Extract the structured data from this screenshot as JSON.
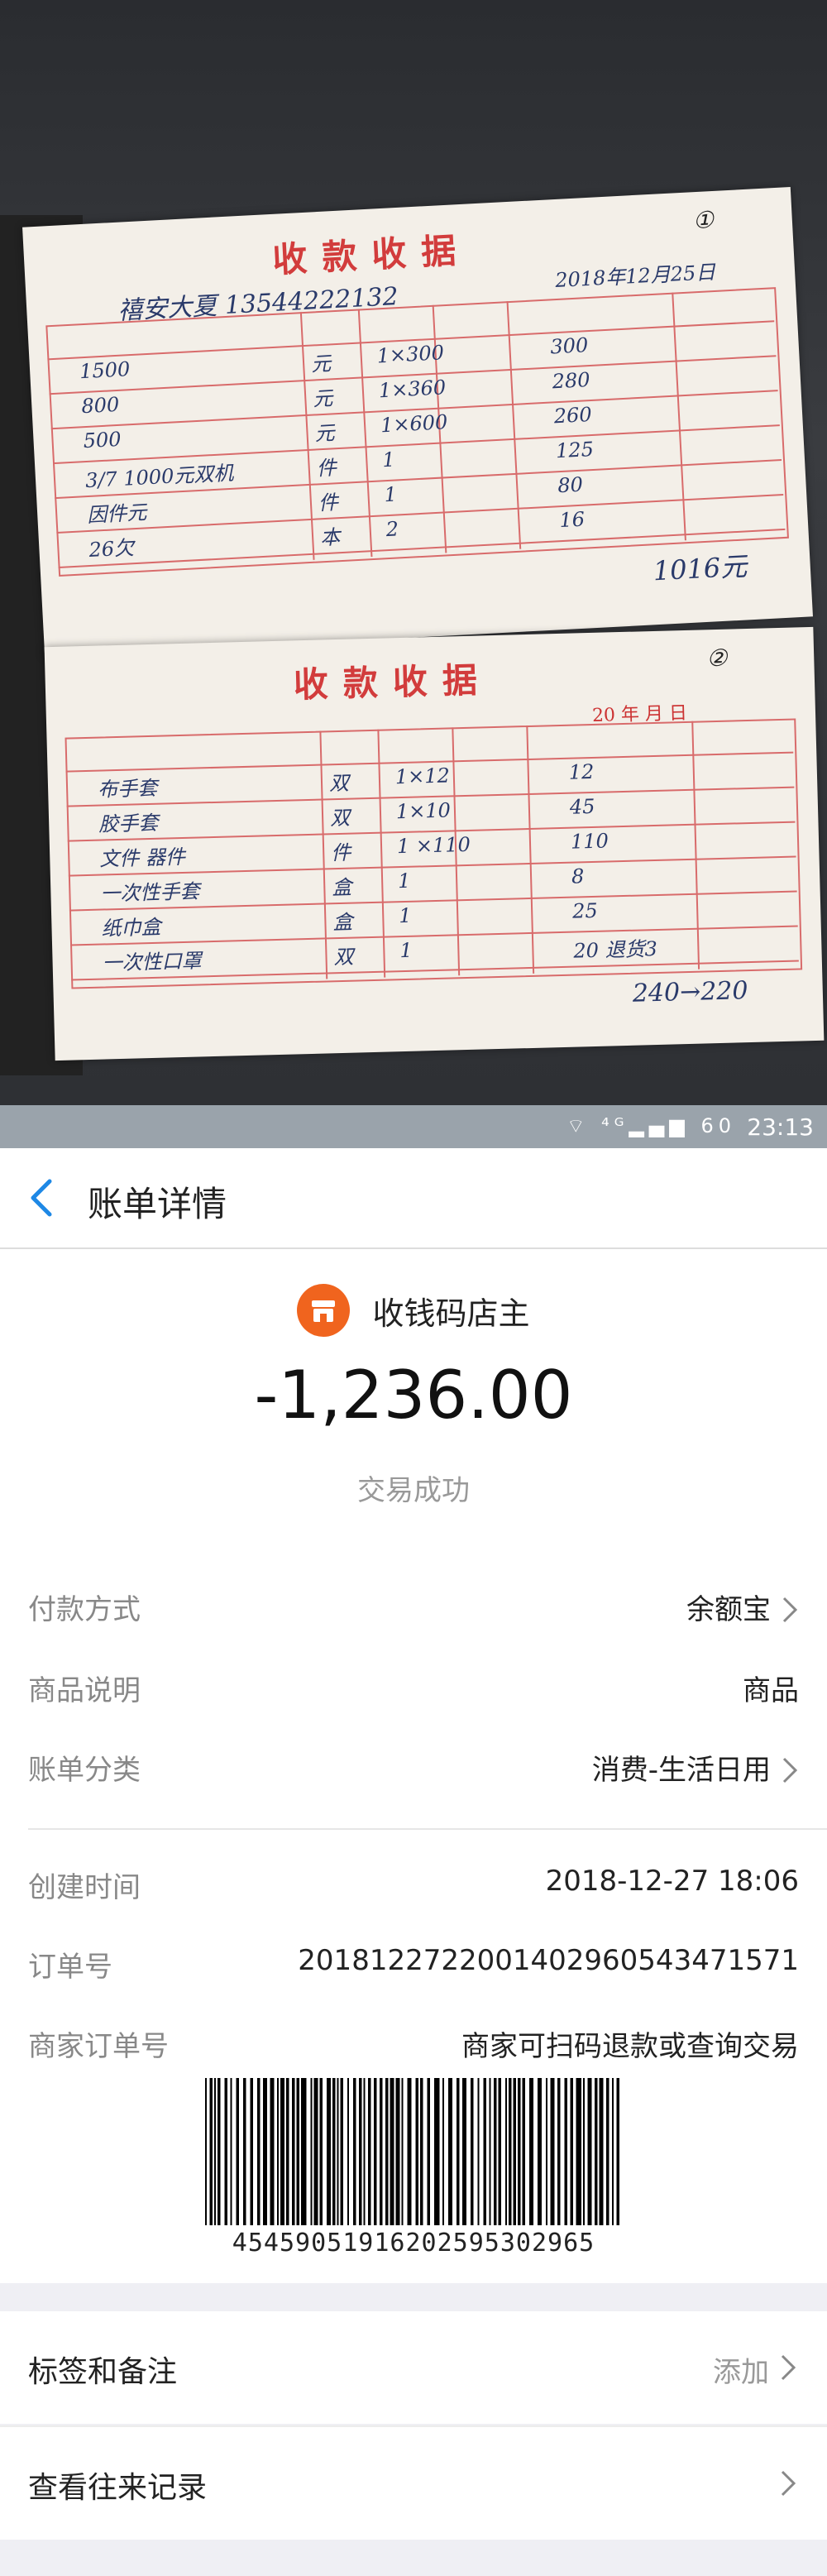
{
  "receipts": [
    {
      "title": "收款收据",
      "circle_num": "①",
      "customer": "禧安大夏 13544222132",
      "date": "2018年12月25日",
      "items": [
        {
          "name": "1500",
          "unit": "元",
          "qty": "1×300",
          "amount": "300"
        },
        {
          "name": "800",
          "unit": "元",
          "qty": "1×360",
          "amount": "280"
        },
        {
          "name": "500",
          "unit": "元",
          "qty": "1×600",
          "amount": "260"
        },
        {
          "name": "3/7 1000元双机",
          "unit": "件",
          "qty": "1",
          "amount": "125"
        },
        {
          "name": "因件元",
          "unit": "件",
          "qty": "1",
          "amount": "80"
        },
        {
          "name": "26欠",
          "unit": "本",
          "qty": "2",
          "amount": "16"
        }
      ],
      "total": "1016元"
    },
    {
      "title": "收款收据",
      "circle_num": "②",
      "customer": "",
      "date": "20 年 月 日",
      "items": [
        {
          "name": "布手套",
          "unit": "双",
          "qty": "1×12",
          "amount": "12"
        },
        {
          "name": "胶手套",
          "unit": "双",
          "qty": "1×10",
          "amount": "45"
        },
        {
          "name": "文件 器件",
          "unit": "件",
          "qty": "1 ×110",
          "amount": "110"
        },
        {
          "name": "一次性手套",
          "unit": "盒",
          "qty": "1",
          "amount": "8"
        },
        {
          "name": "纸巾盒",
          "unit": "盒",
          "qty": "1",
          "amount": "25"
        },
        {
          "name": "一次性口罩",
          "unit": "双",
          "qty": "1",
          "amount": "20 退货3"
        }
      ],
      "total": "240→220"
    }
  ],
  "statusbar": {
    "icons": "⌔ ⁴ᴳ▂▄▆ 60",
    "time": "23:13"
  },
  "header": {
    "title": "账单详情"
  },
  "summary": {
    "merchant": "收钱码店主",
    "amount": "-1,236.00",
    "status": "交易成功"
  },
  "details": {
    "pay_method_label": "付款方式",
    "pay_method_value": "余额宝",
    "desc_label": "商品说明",
    "desc_value": "商品",
    "category_label": "账单分类",
    "category_value": "消费-生活日用",
    "created_label": "创建时间",
    "created_value": "2018-12-27 18:06",
    "order_label": "订单号",
    "order_value": "20181227220014029605434715​71",
    "merchant_order_label": "商家订单号",
    "merchant_order_value": "商家可扫码退款或查询交易",
    "barcode_number": "45459051916202595302965"
  },
  "actions": {
    "tags_label": "标签和备注",
    "tags_hint": "添加",
    "history_label": "查看往来记录"
  },
  "colors": {
    "accent": "#1e88e5",
    "merchant_logo": "#f0641e",
    "receipt_red": "#d23c3c"
  }
}
